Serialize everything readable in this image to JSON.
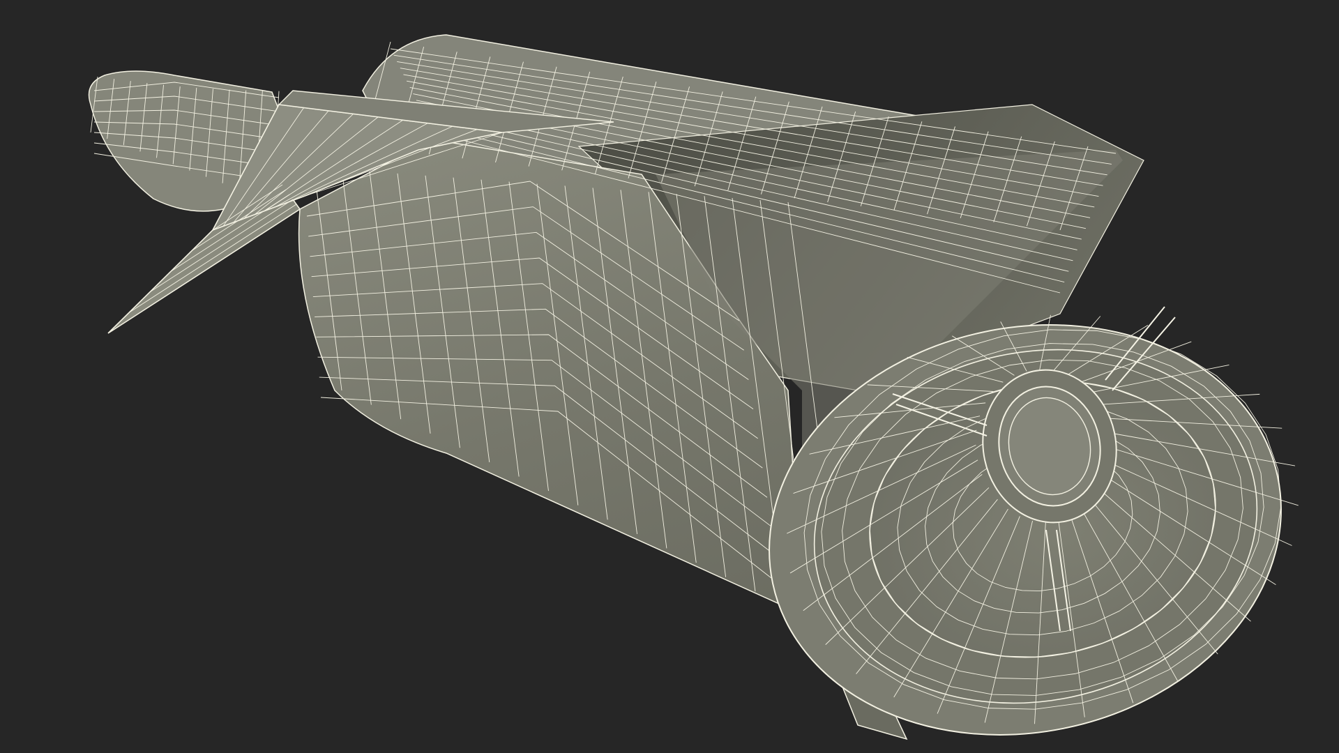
{
  "scene": {
    "background_color": "#262626",
    "mesh_fill": "#7a7b6e",
    "mesh_fill_dark": "#5c5d53",
    "mesh_fill_light": "#8a8b7e",
    "wire_color": "#f3f1e2",
    "object": "wireframe-missile-model"
  }
}
